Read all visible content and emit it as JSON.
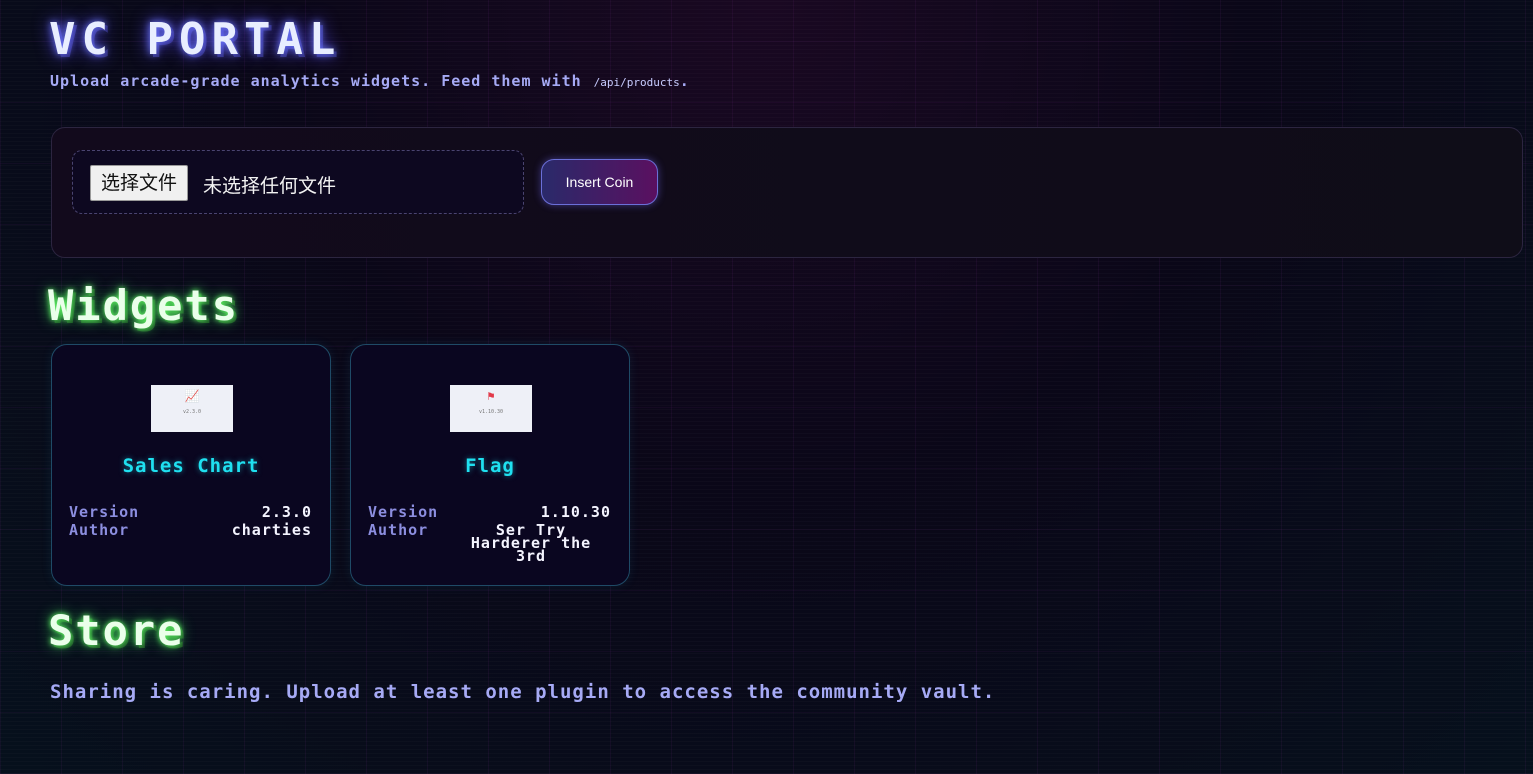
{
  "header": {
    "title": "VC PORTAL",
    "subtitle": "Upload arcade-grade analytics widgets. Feed them with",
    "endpoint": "/api/products",
    "endpoint_suffix": "."
  },
  "upload": {
    "choose_file_label": "选择文件",
    "file_status": "未选择任何文件",
    "submit_label": "Insert Coin"
  },
  "widgets": {
    "title": "Widgets",
    "items": [
      {
        "name": "Sales Chart",
        "thumb_icon": "chart-icon",
        "thumb_version": "v2.3.0",
        "version_label": "Version",
        "version": "2.3.0",
        "author_label": "Author",
        "author": "charties"
      },
      {
        "name": "Flag",
        "thumb_icon": "flag-icon",
        "thumb_version": "v1.10.30",
        "version_label": "Version",
        "version": "1.10.30",
        "author_label": "Author",
        "author": "Ser Try Harderer the 3rd"
      }
    ]
  },
  "store": {
    "title": "Store",
    "message": "Sharing is caring. Upload at least one plugin to access the community vault."
  },
  "colors": {
    "accent_cyan": "#1fe0f0",
    "accent_green_glow": "#6aff6a",
    "label_purple": "#8c8ee0",
    "button_gradient_start": "#2a2a6a",
    "button_gradient_end": "#5a1060"
  }
}
